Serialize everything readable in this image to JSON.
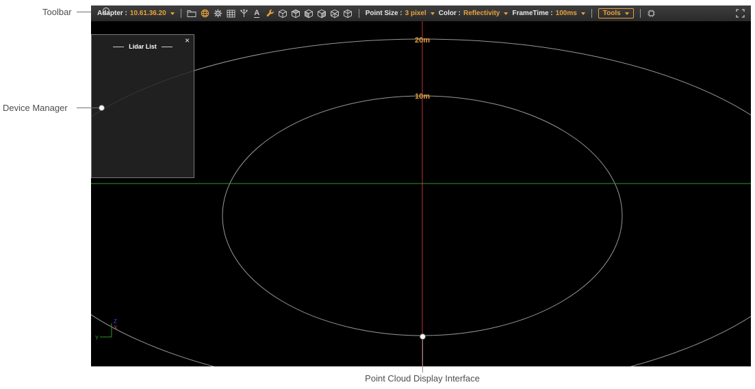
{
  "annotations": {
    "toolbar_label": "Toolbar",
    "device_manager_label": "Device Manager",
    "point_cloud_label": "Point Cloud Display Interface"
  },
  "toolbar": {
    "adapter_label": "Adapter :",
    "adapter_value": "10.61.36.20",
    "point_size_label": "Point Size :",
    "point_size_value": "3 pixel",
    "color_label": "Color :",
    "color_value": "Reflectivity",
    "frame_time_label": "FrameTime :",
    "frame_time_value": "100ms",
    "tools_button_label": "Tools",
    "font_icon_glyph": "A",
    "icons": [
      "folder-icon",
      "globe-icon",
      "gear-icon",
      "table-icon",
      "device-tree-icon",
      "font-icon",
      "wrench-icon",
      "cube-view-icon-1",
      "cube-view-icon-2",
      "cube-view-icon-3",
      "cube-view-icon-4",
      "cube-view-icon-5",
      "cube-view-icon-6",
      "debug-icon",
      "fullscreen-icon"
    ]
  },
  "lidar_list_panel": {
    "title": "Lidar List",
    "close_glyph": "×"
  },
  "display": {
    "range_rings": [
      {
        "label": "20m",
        "radius_m": 20
      },
      {
        "label": "10m",
        "radius_m": 10
      }
    ],
    "axis_labels": {
      "x": "X",
      "y": "Y",
      "z": "Z"
    }
  },
  "colors": {
    "accent_orange": "#e8a23c",
    "grid_green": "#2d9e2d",
    "center_line_red": "#c83232",
    "ring_gray": "#b4b4b4"
  }
}
